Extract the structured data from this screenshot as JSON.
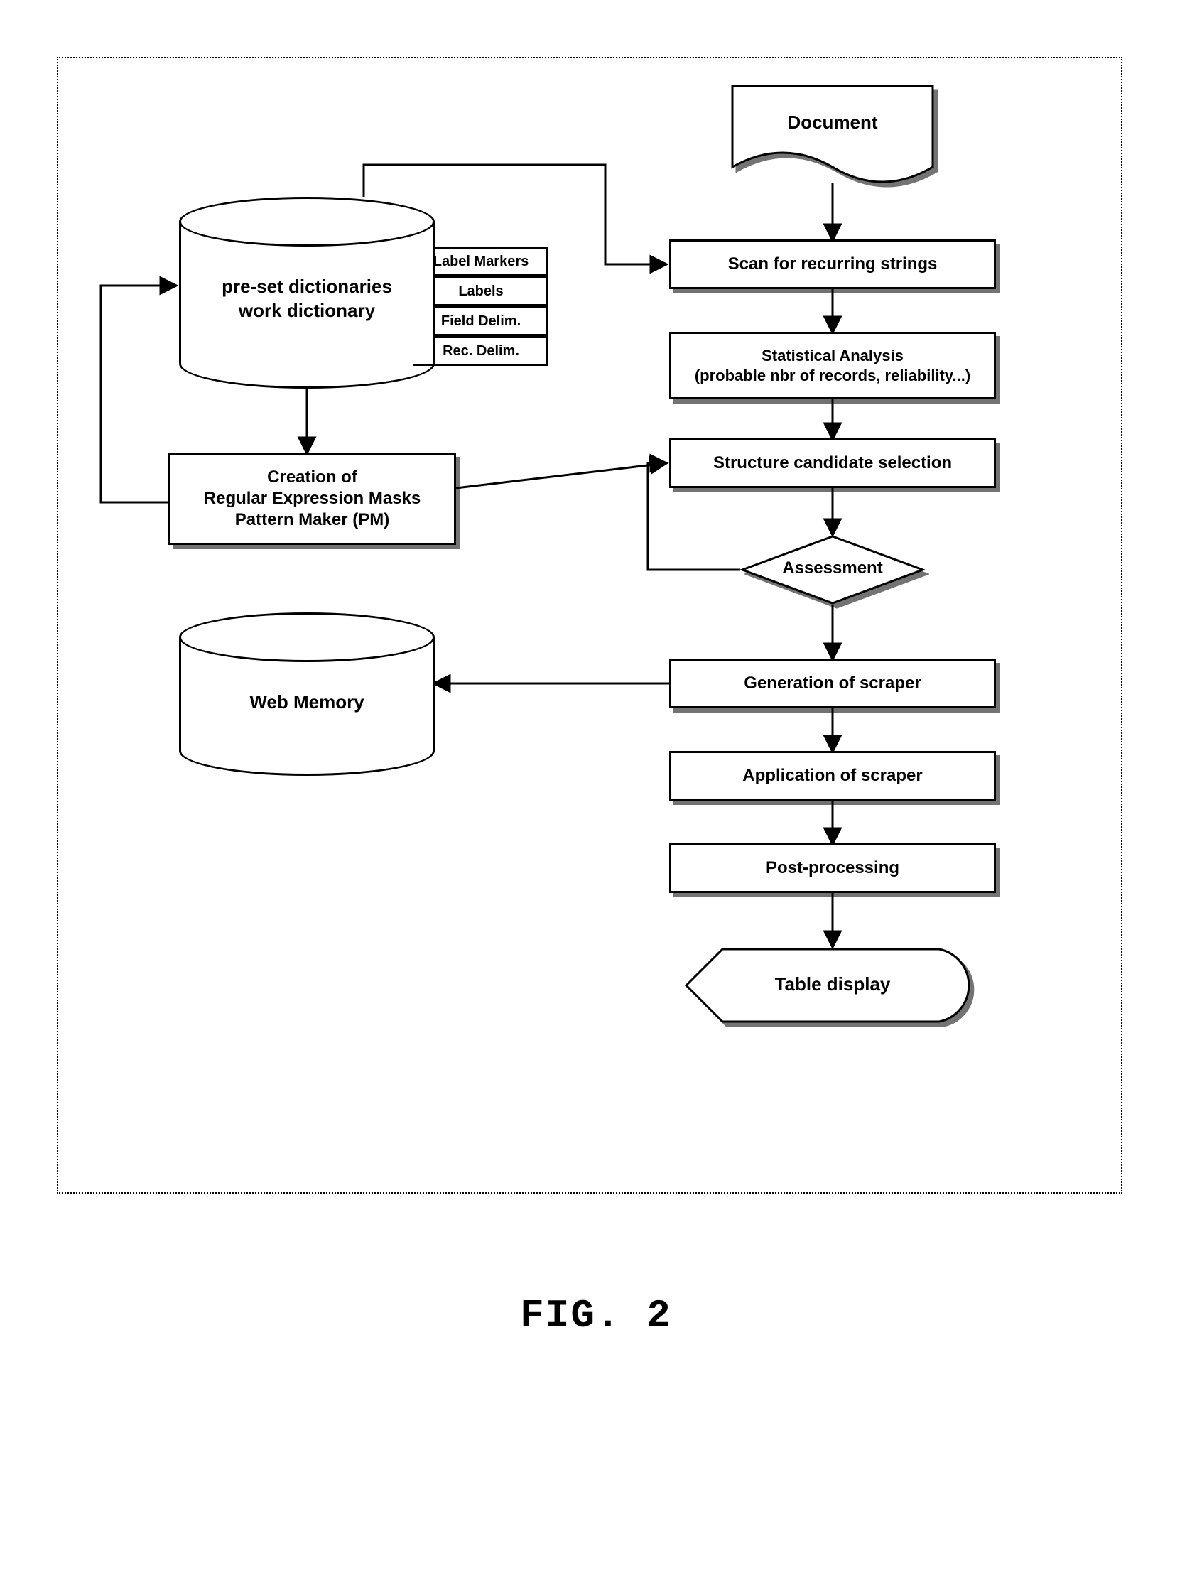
{
  "caption": "FIG. 2",
  "nodes": {
    "document": "Document",
    "scan": "Scan for recurring strings",
    "stat": "Statistical Analysis\n(probable nbr of records, reliability...)",
    "candidate": "Structure candidate selection",
    "assessment": "Assessment",
    "gen_scraper": "Generation of scraper",
    "apply_scraper": "Application of scraper",
    "post": "Post-processing",
    "table": "Table display",
    "dict": "pre-set dictionaries\nwork dictionary",
    "pm": "Creation of\nRegular Expression Masks\nPattern Maker (PM)",
    "web_mem": "Web Memory",
    "dict_tags": {
      "label_markers": "Label Markers",
      "labels": "Labels",
      "field_delim": "Field Delim.",
      "rec_delim": "Rec. Delim."
    }
  },
  "chart_data": {
    "type": "flowchart",
    "nodes": [
      {
        "id": "document",
        "kind": "document",
        "label": "Document"
      },
      {
        "id": "scan",
        "kind": "process",
        "label": "Scan for recurring strings"
      },
      {
        "id": "stat",
        "kind": "process",
        "label": "Statistical Analysis (probable nbr of records, reliability...)"
      },
      {
        "id": "candidate",
        "kind": "process",
        "label": "Structure candidate selection"
      },
      {
        "id": "assessment",
        "kind": "decision",
        "label": "Assessment"
      },
      {
        "id": "gen_scraper",
        "kind": "process",
        "label": "Generation of scraper"
      },
      {
        "id": "apply_scraper",
        "kind": "process",
        "label": "Application of scraper"
      },
      {
        "id": "post",
        "kind": "process",
        "label": "Post-processing"
      },
      {
        "id": "table",
        "kind": "display",
        "label": "Table display"
      },
      {
        "id": "dict",
        "kind": "datastore",
        "label": "pre-set dictionaries / work dictionary",
        "sublabels": [
          "Label Markers",
          "Labels",
          "Field Delim.",
          "Rec. Delim."
        ]
      },
      {
        "id": "pm",
        "kind": "process",
        "label": "Creation of Regular Expression Masks Pattern Maker (PM)"
      },
      {
        "id": "web_mem",
        "kind": "datastore",
        "label": "Web Memory"
      }
    ],
    "edges": [
      {
        "from": "document",
        "to": "scan"
      },
      {
        "from": "scan",
        "to": "stat"
      },
      {
        "from": "stat",
        "to": "candidate"
      },
      {
        "from": "candidate",
        "to": "assessment"
      },
      {
        "from": "assessment",
        "to": "gen_scraper"
      },
      {
        "from": "assessment",
        "to": "candidate",
        "note": "loop back"
      },
      {
        "from": "gen_scraper",
        "to": "apply_scraper"
      },
      {
        "from": "apply_scraper",
        "to": "post"
      },
      {
        "from": "post",
        "to": "table"
      },
      {
        "from": "dict",
        "to": "scan"
      },
      {
        "from": "dict",
        "to": "pm"
      },
      {
        "from": "pm",
        "to": "dict",
        "note": "loop back"
      },
      {
        "from": "pm",
        "to": "candidate"
      },
      {
        "from": "gen_scraper",
        "to": "web_mem"
      }
    ],
    "title": "FIG. 2"
  }
}
